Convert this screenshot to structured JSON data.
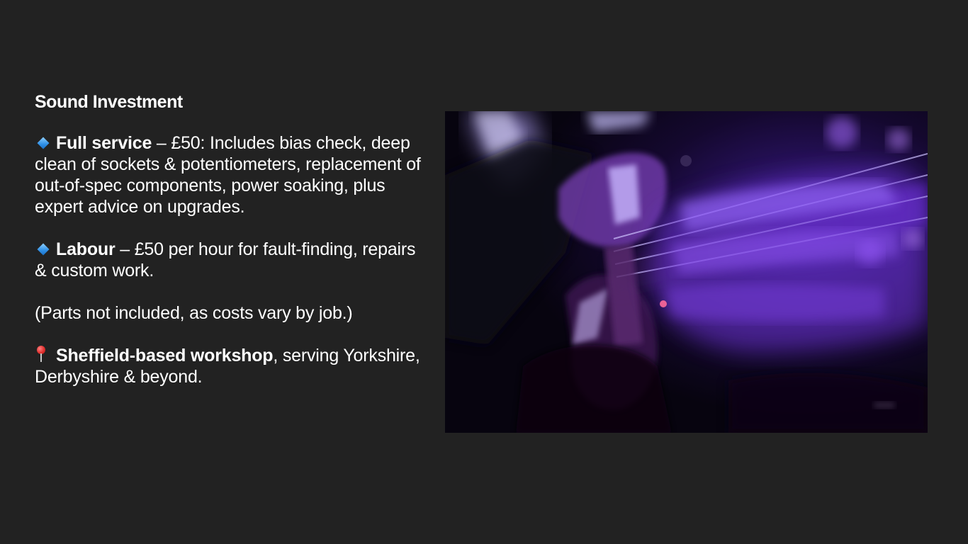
{
  "slide": {
    "heading": "Sound Investment",
    "full_service": {
      "bullet_icon": "blue-diamond-icon",
      "title": "Full service",
      "text": " – £50: Includes bias check, deep clean of sockets & potentiometers, replacement of out-of-spec components, power soaking, plus expert advice on upgrades."
    },
    "labour": {
      "bullet_icon": "blue-diamond-icon",
      "title": "Labour",
      "text": " – £50 per hour for fault-finding, repairs & custom work."
    },
    "parts_note": "(Parts not included, as costs vary by job.)",
    "location": {
      "bullet_icon": "location-pin-icon",
      "title": "Sheffield-based workshop",
      "text": ", serving Yorkshire, Derbyshire & beyond."
    },
    "photo": {
      "subject": "bass-guitar-player-photo"
    },
    "colors": {
      "background": "#222222",
      "text": "#ffffff",
      "accent_blue": "#2e8fe6"
    }
  }
}
